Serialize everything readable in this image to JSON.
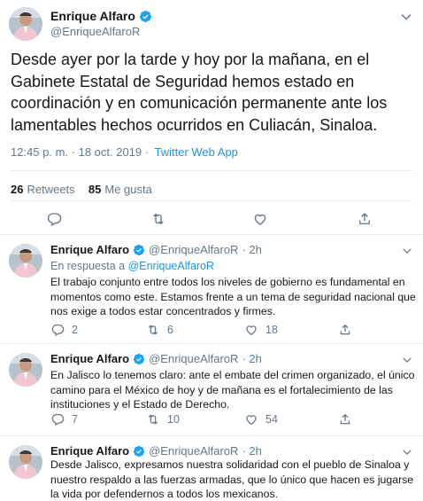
{
  "colors": {
    "accent": "#1b95e0",
    "muted": "#657786",
    "text": "#14171a",
    "border": "#e6ecf0"
  },
  "main_tweet": {
    "author_name": "Enrique Alfaro",
    "author_handle": "@EnriqueAlfaroR",
    "text": "Desde ayer por la tarde y hoy por la mañana, en el Gabinete Estatal de Seguridad hemos estado en coordinación y en comunicación permanente ante los lamentables hechos ocurridos en Culiacán, Sinaloa.",
    "time": "12:45 p. m. · 18 oct. 2019 ·",
    "source": "Twitter Web App",
    "retweets_count": "26",
    "retweets_label": "Retweets",
    "likes_count": "85",
    "likes_label": "Me gusta",
    "icons": [
      "reply-icon",
      "retweet-icon",
      "like-icon",
      "share-icon"
    ]
  },
  "replies": [
    {
      "author_name": "Enrique Alfaro",
      "author_handle": "@EnriqueAlfaroR",
      "age": "· 2h",
      "in_reply_prefix": "En respuesta a",
      "in_reply_handle": "@EnriqueAlfaroR",
      "text": "El trabajo conjunto entre todos los niveles de gobierno es fundamental en momentos como este. Estamos frente a un tema de seguridad nacional que nos exige a todos estar concentrados y firmes.",
      "reply_count": "2",
      "retweet_count": "6",
      "like_count": "18"
    },
    {
      "author_name": "Enrique Alfaro",
      "author_handle": "@EnriqueAlfaroR",
      "age": "· 2h",
      "text": "En Jalisco lo tenemos claro: ante el embate del crimen organizado, el único camino para el México de hoy y de mañana es el fortalecimiento de las instituciones y el Estado de Derecho.",
      "reply_count": "7",
      "retweet_count": "10",
      "like_count": "54"
    },
    {
      "author_name": "Enrique Alfaro",
      "author_handle": "@EnriqueAlfaroR",
      "age": "· 2h",
      "text": "Desde Jalisco, expresamos nuestra solidaridad con el pueblo de Sinaloa y nuestro respaldo a las fuerzas armadas, que lo único que hacen es jugarse la vida por defendernos a todos los mexicanos."
    }
  ]
}
